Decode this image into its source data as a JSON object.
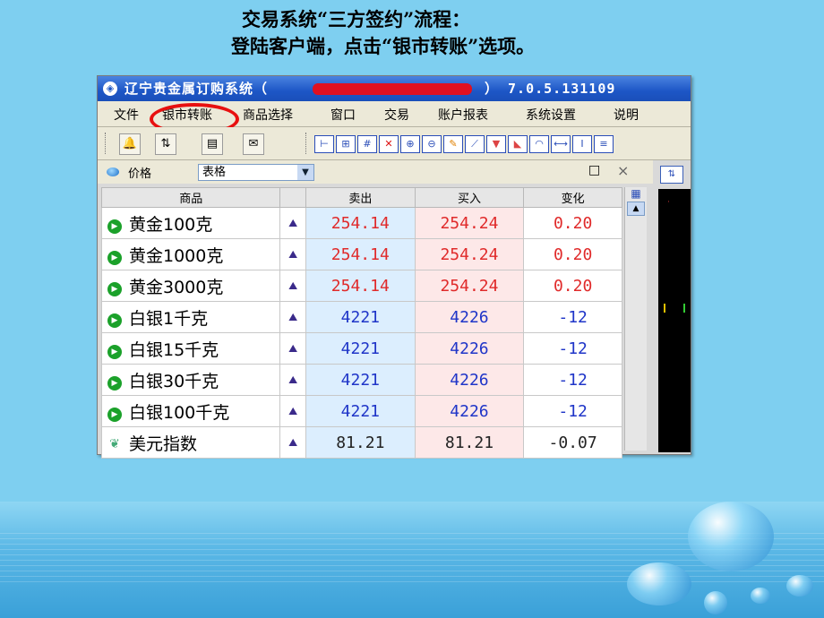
{
  "slide": {
    "title_line1": "交易系统“三方签约”流程：",
    "title_line2": "登陆客户端，点击“银市转账”选项。"
  },
  "window": {
    "title": "辽宁贵金属订购系统（",
    "version": "） 7.0.5.131109"
  },
  "menu": [
    "文件",
    "银市转账",
    "商品选择",
    "窗口",
    "交易",
    "账户报表",
    "系统设置",
    "说明"
  ],
  "panel": {
    "label": "价格",
    "view_select": "表格",
    "close_glyph": "×",
    "square_glyph": "□"
  },
  "table": {
    "headers": [
      "商品",
      "",
      "卖出",
      "买入",
      "变化"
    ],
    "rows": [
      {
        "name": "黄金100克",
        "sell": "254.14",
        "buy": "254.24",
        "change": "0.20",
        "color": "red"
      },
      {
        "name": "黄金1000克",
        "sell": "254.14",
        "buy": "254.24",
        "change": "0.20",
        "color": "red"
      },
      {
        "name": "黄金3000克",
        "sell": "254.14",
        "buy": "254.24",
        "change": "0.20",
        "color": "red"
      },
      {
        "name": "白银1千克",
        "sell": "4221",
        "buy": "4226",
        "change": "-12",
        "color": "blue"
      },
      {
        "name": "白银15千克",
        "sell": "4221",
        "buy": "4226",
        "change": "-12",
        "color": "blue"
      },
      {
        "name": "白银30千克",
        "sell": "4221",
        "buy": "4226",
        "change": "-12",
        "color": "blue"
      },
      {
        "name": "白银100千克",
        "sell": "4221",
        "buy": "4226",
        "change": "-12",
        "color": "blue"
      },
      {
        "name": "美元指数",
        "sell": "81.21",
        "buy": "81.21",
        "change": "-0.07",
        "color": "dark"
      }
    ]
  },
  "colors": {
    "red": "#e02a2a",
    "blue": "#1f35c8",
    "highlight_circle": "#e81010"
  }
}
